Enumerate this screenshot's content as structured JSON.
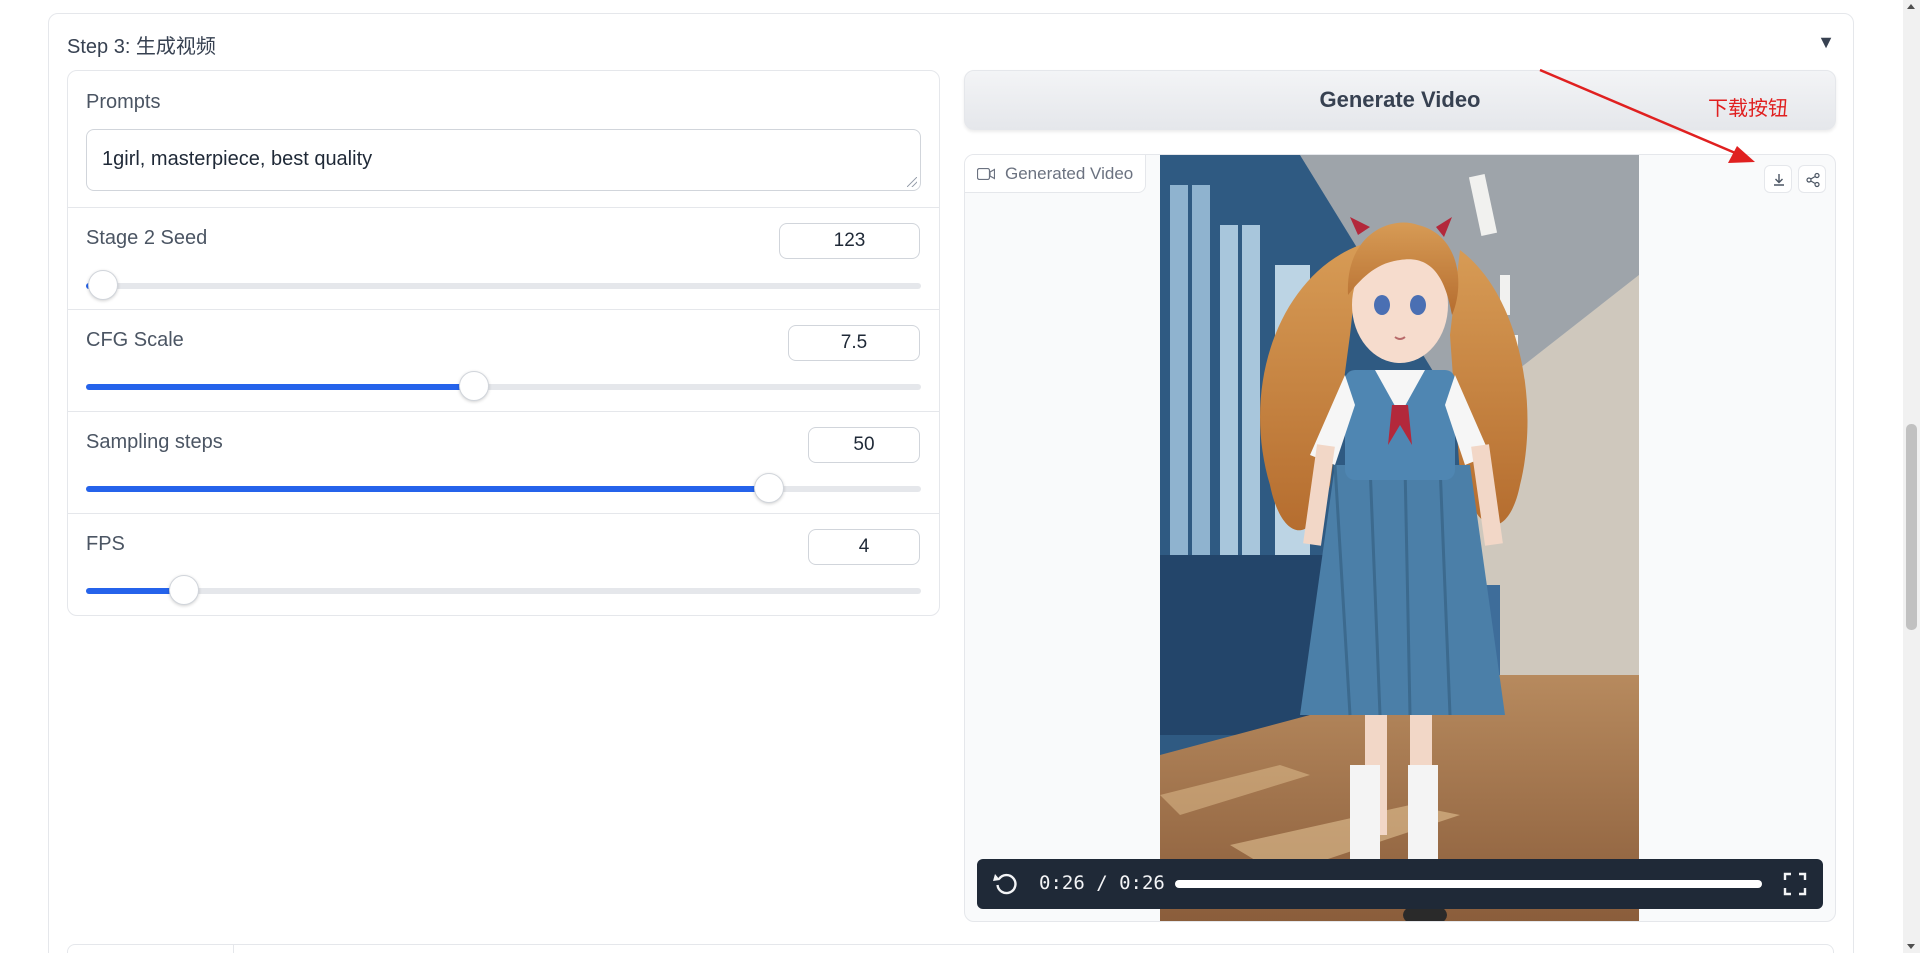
{
  "step3": {
    "title": "Step 3: 生成视频",
    "toggle_glyph": "▼"
  },
  "prompts": {
    "label": "Prompts",
    "value": "1girl, masterpiece, best quality"
  },
  "sliders": [
    {
      "label": "Stage 2 Seed",
      "value": "123",
      "fraction": 0.02
    },
    {
      "label": "CFG Scale",
      "value": "7.5",
      "fraction": 0.465
    },
    {
      "label": "Sampling steps",
      "value": "50",
      "fraction": 0.818
    },
    {
      "label": "FPS",
      "value": "4",
      "fraction": 0.117
    }
  ],
  "generate_button": {
    "label": "Generate Video"
  },
  "video": {
    "label": "Generated Video",
    "time": "0:26 / 0:26",
    "progress": 1.0,
    "icons": [
      "camera-icon",
      "download-icon",
      "share-icon",
      "replay-icon",
      "fullscreen-icon"
    ]
  },
  "annotation": {
    "text": "下载按钮",
    "color": "#e02020"
  },
  "colors": {
    "accent": "#2563eb",
    "controls_bg": "#1f2937"
  }
}
